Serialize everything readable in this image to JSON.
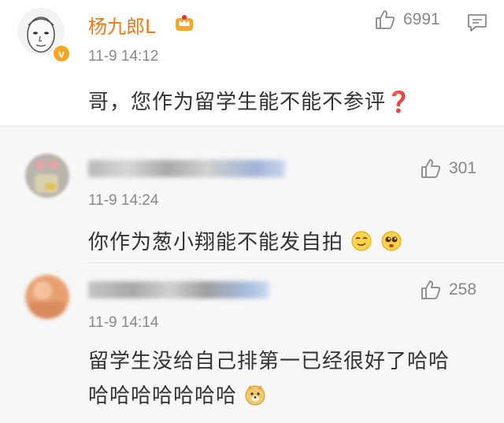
{
  "main": {
    "username": "杨九郎L",
    "badge": "v",
    "time": "11-9 14:12",
    "text": "哥，您作为留学生能不能不参评❓",
    "likes": "6991"
  },
  "replies": [
    {
      "time": "11-9 14:24",
      "text": "你作为葱小翔能不能发自拍",
      "likes": "301"
    },
    {
      "time": "11-9 14:14",
      "text_line1": "留学生没给自己排第一已经很好了哈哈",
      "text_line2": "哈哈哈哈哈哈哈",
      "likes": "258"
    }
  ],
  "colors": {
    "username": "#ee7a16",
    "badge": "#f5a623",
    "reply_bg": "#f7f7f7"
  },
  "icons": [
    "thumbs-up-icon",
    "reply-comment-icon",
    "crown-badge-icon",
    "verified-v-icon",
    "smirk-emoji-icon",
    "puppy-eyes-emoji-icon",
    "doge-emoji-icon"
  ]
}
